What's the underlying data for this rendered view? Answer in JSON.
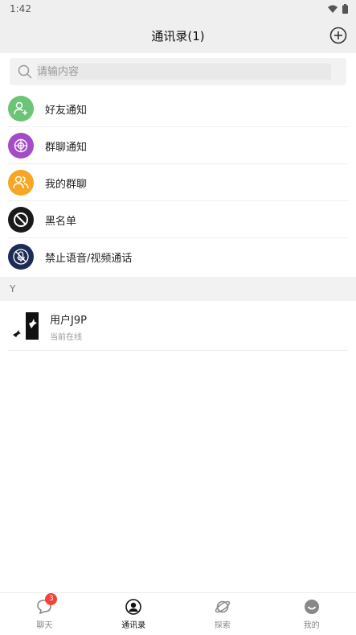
{
  "status_bar": {
    "time": "1:42"
  },
  "header": {
    "title": "通讯录(1)",
    "add_icon": "plus-circle-icon"
  },
  "search": {
    "placeholder": "请输内容",
    "value": ""
  },
  "menu": {
    "items": [
      {
        "label": "好友通知",
        "icon": "add-friend-icon",
        "color": "#6cc477"
      },
      {
        "label": "群聊通知",
        "icon": "group-target-icon",
        "color": "#a24cc7"
      },
      {
        "label": "我的群聊",
        "icon": "group-people-icon",
        "color": "#f5a623"
      },
      {
        "label": "黑名单",
        "icon": "block-icon",
        "color": "#1a1a1a"
      },
      {
        "label": "禁止语音/视频通话",
        "icon": "mute-mic-icon",
        "color": "#1d2c57"
      }
    ]
  },
  "section": {
    "letter": "Y"
  },
  "contacts": [
    {
      "name": "用户J9P",
      "status": "当前在线"
    }
  ],
  "bottom_nav": {
    "items": [
      {
        "label": "聊天",
        "icon": "chat-icon",
        "badge": "3"
      },
      {
        "label": "通讯录",
        "icon": "contacts-icon",
        "active": true
      },
      {
        "label": "探索",
        "icon": "planet-icon"
      },
      {
        "label": "我的",
        "icon": "profile-smile-icon"
      }
    ]
  }
}
